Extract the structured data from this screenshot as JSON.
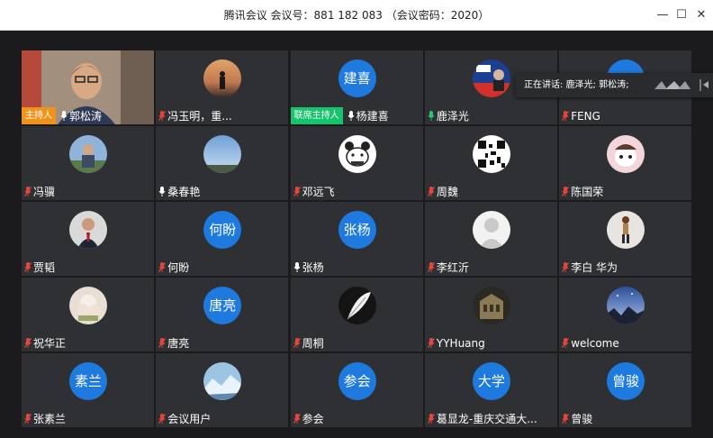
{
  "window": {
    "title": "腾讯会议 会议号：881 182 083 （会议密码：2020）",
    "minimize": "—",
    "maximize": "☐",
    "close": "✕"
  },
  "speaking": {
    "label": "正在讲话: 鹿泽光; 郭松涛;"
  },
  "badges": {
    "host": "主持人",
    "cohost": "联席主持人"
  },
  "colors": {
    "initials_bg": "#1f7ae0",
    "host_badge": "#f0931c",
    "cohost_badge": "#16c46c",
    "mic_muted": "#e6453a",
    "mic_active": "#27c76a",
    "mic_normal": "#ffffff"
  },
  "participants": [
    {
      "name": "郭松涛",
      "badge": "host",
      "mic": "normal",
      "avatar": "video"
    },
    {
      "name": "冯玉明，重...",
      "mic": "muted",
      "avatar": "sunset"
    },
    {
      "name": "杨建喜",
      "badge": "cohost",
      "mic": "normal",
      "avatar": "initials",
      "initials": "建喜"
    },
    {
      "name": "鹿泽光",
      "mic": "active",
      "avatar": "poster"
    },
    {
      "name": "FENG",
      "mic": "muted",
      "avatar": "partial"
    },
    {
      "name": "冯骥",
      "mic": "muted",
      "avatar": "man-photo"
    },
    {
      "name": "桑春艳",
      "mic": "normal",
      "avatar": "sky"
    },
    {
      "name": "邓远飞",
      "mic": "muted",
      "avatar": "bear"
    },
    {
      "name": "周魏",
      "mic": "muted",
      "avatar": "qr"
    },
    {
      "name": "陈国荣",
      "mic": "muted",
      "avatar": "cartoon"
    },
    {
      "name": "贾韬",
      "mic": "muted",
      "avatar": "suit"
    },
    {
      "name": "何盼",
      "mic": "muted",
      "avatar": "initials",
      "initials": "何盼"
    },
    {
      "name": "张杨",
      "mic": "normal",
      "avatar": "initials",
      "initials": "张杨"
    },
    {
      "name": "李红沂",
      "mic": "muted",
      "avatar": "default"
    },
    {
      "name": "李白 华为",
      "mic": "muted",
      "avatar": "figure"
    },
    {
      "name": "祝华正",
      "mic": "muted",
      "avatar": "flower"
    },
    {
      "name": "唐亮",
      "mic": "muted",
      "avatar": "initials",
      "initials": "唐亮"
    },
    {
      "name": "周桐",
      "mic": "muted",
      "avatar": "feather"
    },
    {
      "name": "YYHuang",
      "mic": "muted",
      "avatar": "building"
    },
    {
      "name": "welcome",
      "mic": "muted",
      "avatar": "night"
    },
    {
      "name": "张素兰",
      "mic": "muted",
      "avatar": "initials",
      "initials": "素兰"
    },
    {
      "name": "会议用户",
      "mic": "muted",
      "avatar": "glacier"
    },
    {
      "name": "参会",
      "mic": "muted",
      "avatar": "initials",
      "initials": "参会"
    },
    {
      "name": "葛显龙-重庆交通大...",
      "mic": "muted",
      "avatar": "initials",
      "initials": "大学"
    },
    {
      "name": "曾骏",
      "mic": "muted",
      "avatar": "initials",
      "initials": "曾骏"
    }
  ]
}
